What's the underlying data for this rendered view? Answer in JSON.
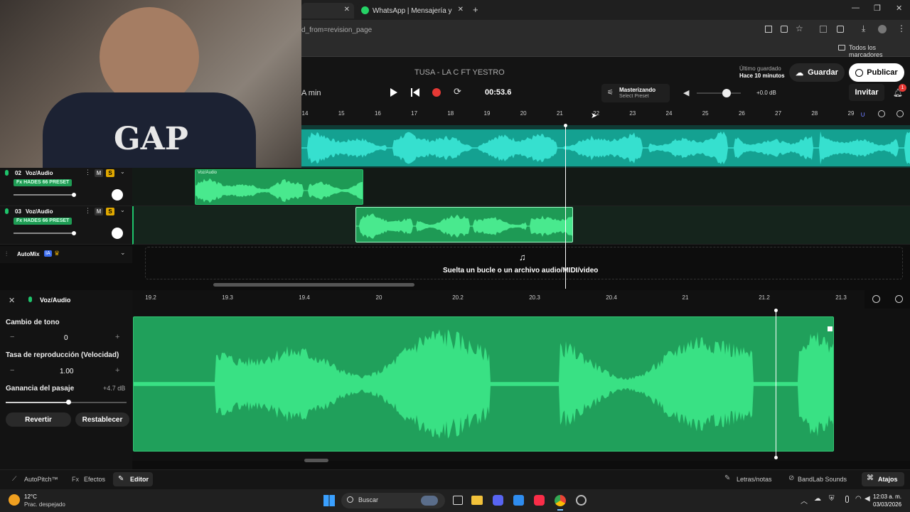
{
  "browser": {
    "tab_active_label": "WhatsApp | Mensajería y llama",
    "url_fragment": "d_from=revision_page",
    "bookmarks_label": "Todos los marcadores"
  },
  "header": {
    "song_title": "TUSA - LA C FT YESTRO",
    "last_saved_label": "Último guardado",
    "last_saved_time": "Hace 10 minutos",
    "save_label": "Guardar",
    "publish_label": "Publicar",
    "min_label": "A min",
    "time_display": "00:53.6",
    "mastering_title": "Masterizando",
    "mastering_preset": "Select Preset",
    "volume_db": "+0.0 dB",
    "invite_label": "Invitar",
    "notifications_count": "1"
  },
  "ruler": {
    "ticks": [
      "14",
      "15",
      "16",
      "17",
      "18",
      "19",
      "20",
      "21",
      "22",
      "23",
      "24",
      "25",
      "26",
      "27",
      "28",
      "29"
    ]
  },
  "tracks": [
    {
      "number": "02",
      "name": "Voz/Audio",
      "fx": "HADES 66 PRESET",
      "clip_label": "Voz/Audio",
      "mute": "M",
      "solo": "S"
    },
    {
      "number": "03",
      "name": "Voz/Audio",
      "fx": "HADES 66 PRESET",
      "mute": "M",
      "solo": "S"
    }
  ],
  "automix": {
    "label": "AutoMix",
    "badge": "IA"
  },
  "dropzone": {
    "text": "Suelta un bucle o un archivo audio/MIDI/video"
  },
  "editor": {
    "track_name": "Voz/Audio",
    "pitch_label": "Cambio de tono",
    "pitch_value": "0",
    "rate_label": "Tasa de reproducción (Velocidad)",
    "rate_value": "1.00",
    "gain_label": "Ganancia del pasaje",
    "gain_value": "+4.7 dB",
    "gain_level": 0.52,
    "revert_label": "Revertir",
    "reset_label": "Restablecer",
    "ticks": [
      "19.2",
      "19.3",
      "19.4",
      "20",
      "20.2",
      "20.3",
      "20.4",
      "21",
      "21.2",
      "21.3"
    ]
  },
  "bottom": {
    "autopitch": "AutoPitch™",
    "effects": "Efectos",
    "editor": "Editor",
    "lyrics": "Letras/notas",
    "sounds": "BandLab Sounds",
    "shortcuts": "Atajos"
  },
  "taskbar": {
    "temp": "12°C",
    "weather": "Prac. despejado",
    "search": "Buscar",
    "time": "12:03 a. m.",
    "date": "03/03/2026"
  },
  "colors": {
    "accent": "#1ec46b",
    "record": "#e53935",
    "clip": "#1e9a55"
  }
}
